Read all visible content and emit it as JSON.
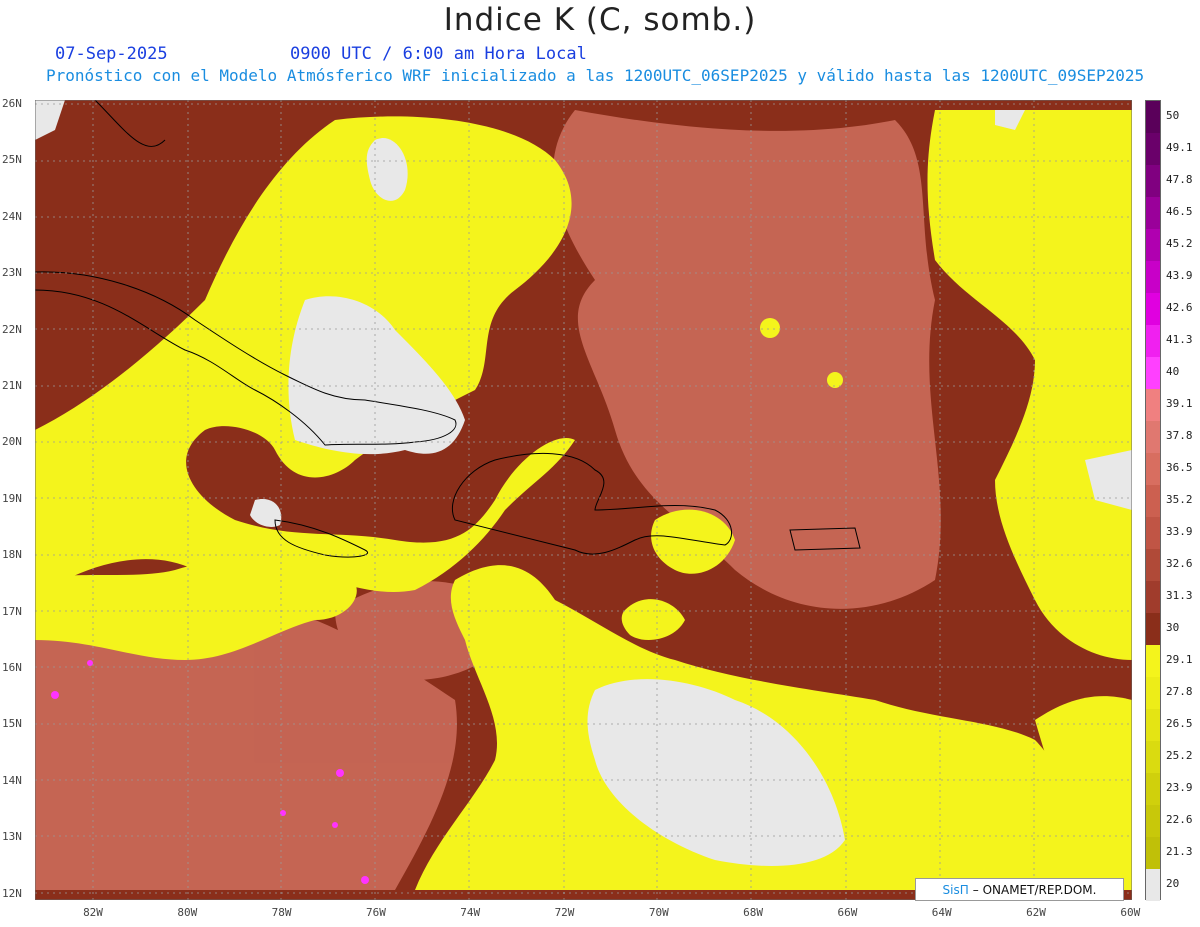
{
  "title": "Indice K (C, somb.)",
  "date": "07-Sep-2025",
  "valid_time": "0900 UTC / 6:00 am Hora Local",
  "subtitle": "Pronóstico con el Modelo Atmósferico WRF inicializado a las 1200UTC_06SEP2025 y válido hasta las  1200UTC_09SEP2025",
  "map": {
    "lat_labels": [
      "26N",
      "25N",
      "24N",
      "23N",
      "22N",
      "21N",
      "20N",
      "19N",
      "18N",
      "17N",
      "16N",
      "15N",
      "14N",
      "13N",
      "12N"
    ],
    "lon_labels": [
      "82W",
      "80W",
      "78W",
      "76W",
      "74W",
      "72W",
      "70W",
      "68W",
      "66W",
      "64W",
      "62W",
      "60W"
    ],
    "lat_range": [
      12,
      26
    ],
    "lon_range": [
      -83,
      -60
    ],
    "grid": true,
    "colors": {
      "yellow": "#f4f41c",
      "olive": "#c4c40a",
      "light_gray": "#e8e8e8",
      "dark_red": "#8a2e1a",
      "mid_red": "#b04a38",
      "salmon": "#cf6e5e",
      "magenta": "#ff33ff",
      "coast": "#000000"
    }
  },
  "colorbar": {
    "labels": [
      "50",
      "49.1",
      "47.8",
      "46.5",
      "45.2",
      "43.9",
      "42.6",
      "41.3",
      "40",
      "39.1",
      "37.8",
      "36.5",
      "35.2",
      "33.9",
      "32.6",
      "31.3",
      "30",
      "29.1",
      "27.8",
      "26.5",
      "25.2",
      "23.9",
      "22.6",
      "21.3",
      "20"
    ],
    "colors": [
      "#5a005a",
      "#6a006a",
      "#800080",
      "#9a009a",
      "#b000b0",
      "#c800c8",
      "#e000e0",
      "#f020f0",
      "#ff40ff",
      "#f08080",
      "#e07870",
      "#d86e60",
      "#cc6050",
      "#c05545",
      "#b04a38",
      "#a03c2c",
      "#8a2e1a",
      "#f4f41c",
      "#eded18",
      "#e4e414",
      "#dadb10",
      "#d0d00c",
      "#c8c80a",
      "#c0c008",
      "#e8e8e8"
    ]
  },
  "credit": {
    "brand": "SisΠ",
    "org": "– ONAMET/REP.DOM."
  }
}
